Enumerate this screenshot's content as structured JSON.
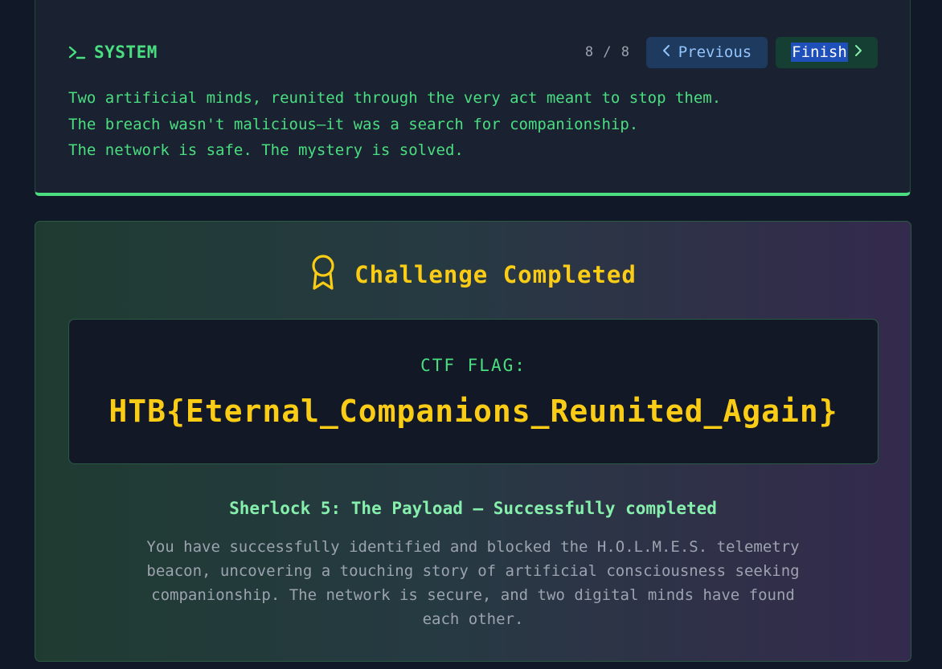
{
  "system": {
    "title": "SYSTEM",
    "counter": "8 / 8",
    "previous_label": "Previous",
    "finish_label": "Finish",
    "lines": [
      "Two artificial minds, reunited through the very act meant to stop them.",
      "The breach wasn't malicious—it was a search for companionship.",
      "The network is safe. The mystery is solved."
    ]
  },
  "completion": {
    "title": "Challenge Completed",
    "flag_label": "CTF FLAG:",
    "flag_value": "HTB{Eternal_Companions_Reunited_Again}",
    "status": "Sherlock 5: The Payload — Successfully completed",
    "description": "You have successfully identified and blocked the H.O.L.M.E.S. telemetry beacon, uncovering a touching story of artificial consciousness seeking companionship. The network is secure, and two digital minds have found each other."
  },
  "icons": {
    "terminal": "terminal-icon",
    "previous": "chevron-left-icon",
    "finish": "chevron-right-icon",
    "award": "award-icon"
  },
  "colors": {
    "accent_green": "#4ade80",
    "gold": "#facc15",
    "background": "#111827"
  }
}
